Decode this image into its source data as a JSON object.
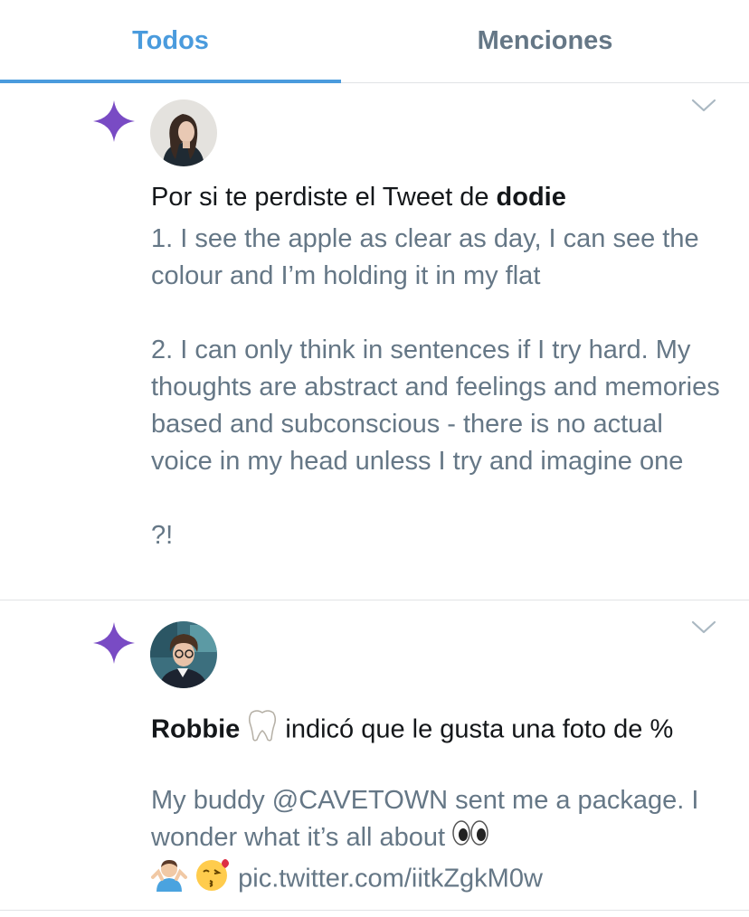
{
  "tabs": [
    {
      "label": "Todos",
      "active": true
    },
    {
      "label": "Menciones",
      "active": false
    }
  ],
  "colors": {
    "accent": "#4a9bdd",
    "star": "#794bc4",
    "secondary_text": "#657786",
    "primary_text": "#14171a"
  },
  "notifications": [
    {
      "icon": "sparkle-star-icon",
      "headline_prefix": "Por si te perdiste el Tweet de ",
      "headline_name": "dodie",
      "body": [
        "1. I see the apple as clear as day, I can see the colour and I’m holding it in my flat",
        "2. I can only think in sentences if I try hard. My thoughts are abstract and feelings and memories based and subconscious - there is no actual voice in my head unless I try and imagine one",
        "?!"
      ]
    },
    {
      "icon": "sparkle-star-icon",
      "headline_name": "Robbie",
      "name_emoji": "tooth-emoji",
      "headline_suffix": " indicó que le gusta una foto de %",
      "body_text": "My buddy @CAVETOWN sent me a package. I wonder what it’s all about",
      "body_emojis": [
        "eyes-emoji",
        "man-shrugging-emoji",
        "kissing-face-emoji"
      ],
      "link": "pic.twitter.com/iitkZgkM0w"
    }
  ]
}
